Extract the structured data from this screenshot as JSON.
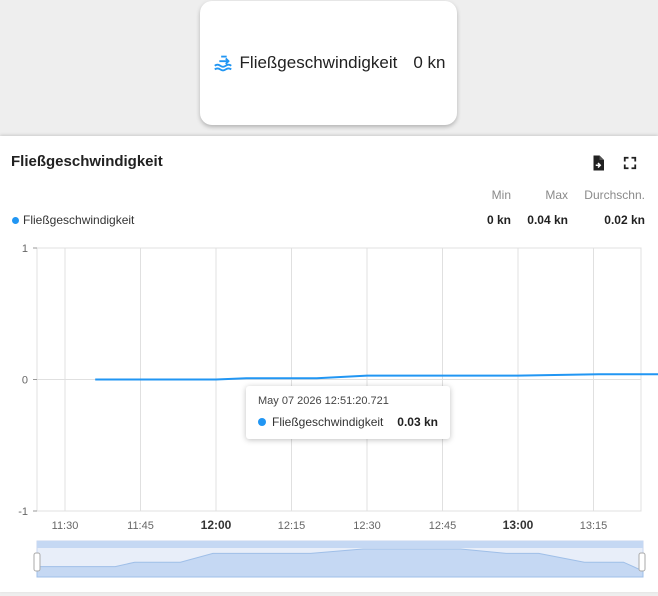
{
  "tile": {
    "name": "Fließgeschwindigkeit",
    "value": "0 kn",
    "icon": "water-flow-icon"
  },
  "panel": {
    "title": "Fließgeschwindigkeit",
    "download_icon": "file-export-icon",
    "fullscreen_icon": "fullscreen-icon"
  },
  "stats": {
    "headers": {
      "min": "Min",
      "max": "Max",
      "avg": "Durchschn."
    },
    "series_name": "Fließgeschwindigkeit",
    "min": "0 kn",
    "max": "0.04 kn",
    "avg": "0.02 kn"
  },
  "tooltip": {
    "time": "May 07 2026 12:51:20.721",
    "series": "Fließgeschwindigkeit",
    "value": "0.03 kn"
  },
  "colors": {
    "series": "#2196f3",
    "grid": "#e0e0e0",
    "zoom_fill": "#d6e4f7"
  },
  "chart_data": {
    "type": "line",
    "ylim": [
      -1,
      1
    ],
    "yticks": [
      "1",
      "0",
      "-1"
    ],
    "xticks": [
      "11:30",
      "11:45",
      "12:00",
      "12:15",
      "12:30",
      "12:45",
      "13:00",
      "13:15"
    ],
    "xticks_bold": [
      false,
      false,
      true,
      false,
      false,
      false,
      true,
      false
    ],
    "series": [
      {
        "x_minutes": [
          -24,
          -20,
          -10,
          0,
          6,
          15,
          20,
          30,
          45,
          60,
          76,
          90,
          106,
          120,
          130,
          144,
          150,
          156,
          162
        ],
        "values": [
          0.0,
          0.0,
          0.0,
          0.0,
          0.01,
          0.01,
          0.01,
          0.03,
          0.03,
          0.03,
          0.04,
          0.04,
          0.04,
          0.03,
          0.03,
          0.01,
          0.01,
          0.01,
          -0.01
        ]
      }
    ],
    "hover_x_minutes": 111
  }
}
